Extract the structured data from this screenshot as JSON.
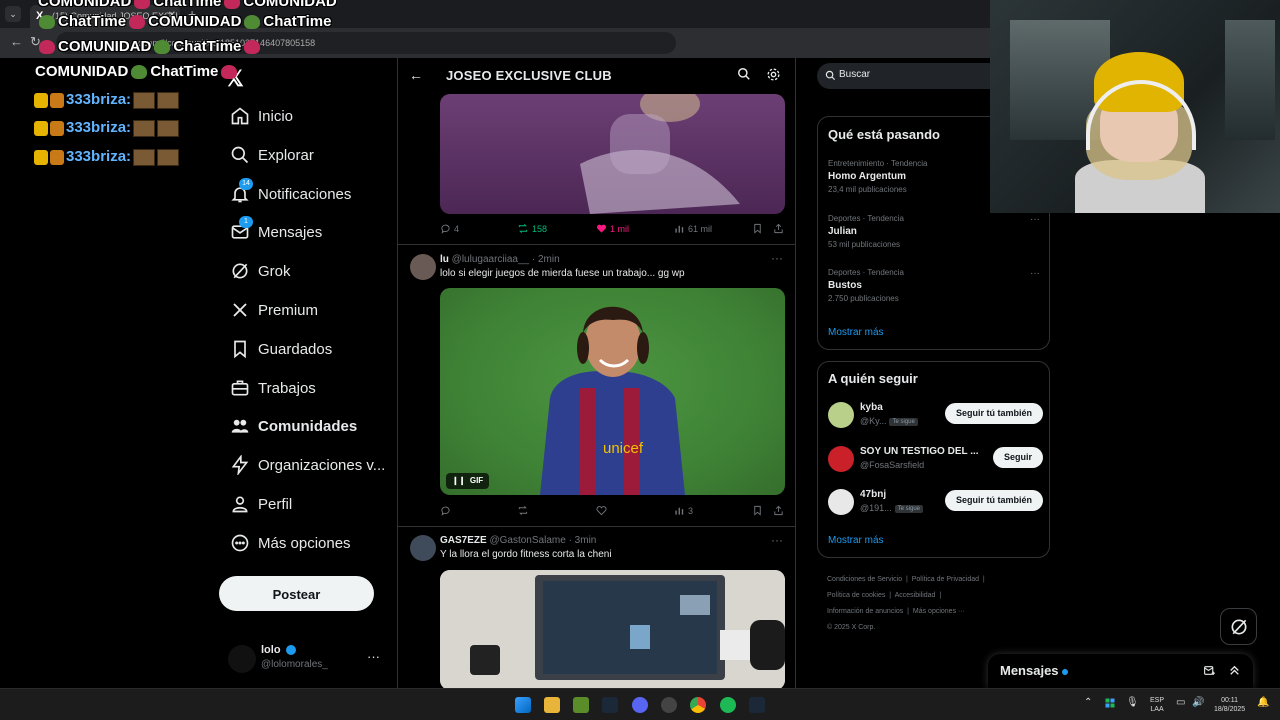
{
  "browser": {
    "tab_title": "(15) Comunidad JOSEO EXCLU...",
    "url": "x.com/i/communities/1851037146407805158"
  },
  "overlay": {
    "text_comunidad": "COMUNIDAD",
    "text_chattime": "ChatTime",
    "chat_rows": [
      {
        "user": "333briza:"
      },
      {
        "user": "333briza:"
      },
      {
        "user": "333briza:"
      }
    ]
  },
  "nav": {
    "items": [
      {
        "label": "Inicio",
        "badge": ""
      },
      {
        "label": "Explorar",
        "badge": ""
      },
      {
        "label": "Notificaciones",
        "badge": "14"
      },
      {
        "label": "Mensajes",
        "badge": "1"
      },
      {
        "label": "Grok",
        "badge": ""
      },
      {
        "label": "Premium",
        "badge": ""
      },
      {
        "label": "Guardados",
        "badge": ""
      },
      {
        "label": "Trabajos",
        "badge": ""
      },
      {
        "label": "Comunidades",
        "badge": ""
      },
      {
        "label": "Organizaciones v...",
        "badge": ""
      },
      {
        "label": "Perfil",
        "badge": ""
      },
      {
        "label": "Más opciones",
        "badge": ""
      }
    ],
    "post_button": "Postear",
    "account": {
      "name": "lolo",
      "handle": "@lolomorales_",
      "more": "···"
    }
  },
  "feed": {
    "title": "JOSEO EXCLUSIVE CLUB",
    "posts": [
      {
        "replies": "4",
        "reposts": "158",
        "likes": "1 mil",
        "views": "61 mil"
      },
      {
        "name": "lu",
        "handle": "@lulugaarciiaa__",
        "time": "· 2min",
        "text": "lolo si elegir juegos de mierda fuese un trabajo... gg wp",
        "gif_label": "GIF",
        "replies": "",
        "reposts": "",
        "likes": "",
        "views": "3"
      },
      {
        "name": "GAS7EZE",
        "handle": "@GastonSalame",
        "time": "· 3min",
        "text": "Y la llora el gordo fitness corta la cheni"
      }
    ]
  },
  "right": {
    "search_placeholder": "Buscar",
    "trends_title": "Qué está pasando",
    "trends": [
      {
        "category": "Entretenimiento · Tendencia",
        "name": "Homo Argentum",
        "count": "23,4 mil publicaciones"
      },
      {
        "category": "Deportes · Tendencia",
        "name": "Julian",
        "count": "53 mil publicaciones"
      },
      {
        "category": "Deportes · Tendencia",
        "name": "Bustos",
        "count": "2.750 publicaciones"
      }
    ],
    "show_more": "Mostrar más",
    "follow_title": "A quién seguir",
    "follow": [
      {
        "name": "kyba",
        "handle": "@Ky...",
        "tag": "Te sigue",
        "button": "Seguir tú también",
        "avatar_color": "#b9d08a"
      },
      {
        "name": "SOY UN TESTIGO DEL ...",
        "handle": "@FosaSarsfield",
        "tag": "",
        "button": "Seguir",
        "avatar_color": "#c9202a"
      },
      {
        "name": "47bnj",
        "handle": "@191...",
        "tag": "Te sigue",
        "button": "Seguir tú también",
        "avatar_color": "#e8e8e8"
      }
    ],
    "show_more_follow": "Mostrar más",
    "footer": {
      "terms": "Condiciones de Servicio",
      "privacy": "Política de Privacidad",
      "cookies": "Política de cookies",
      "accessibility": "Accesibilidad",
      "ads": "Información de anuncios",
      "more": "Más opciones ···",
      "copyright": "© 2025 X Corp."
    }
  },
  "messages": {
    "title": "Mensajes"
  },
  "taskbar": {
    "lang_top": "ESP",
    "lang_bottom": "LAA",
    "time": "00:11",
    "date": "18/8/2025"
  },
  "colors": {
    "accent": "#1d9bf0",
    "repost": "#00ba7c",
    "like": "#f91880"
  }
}
